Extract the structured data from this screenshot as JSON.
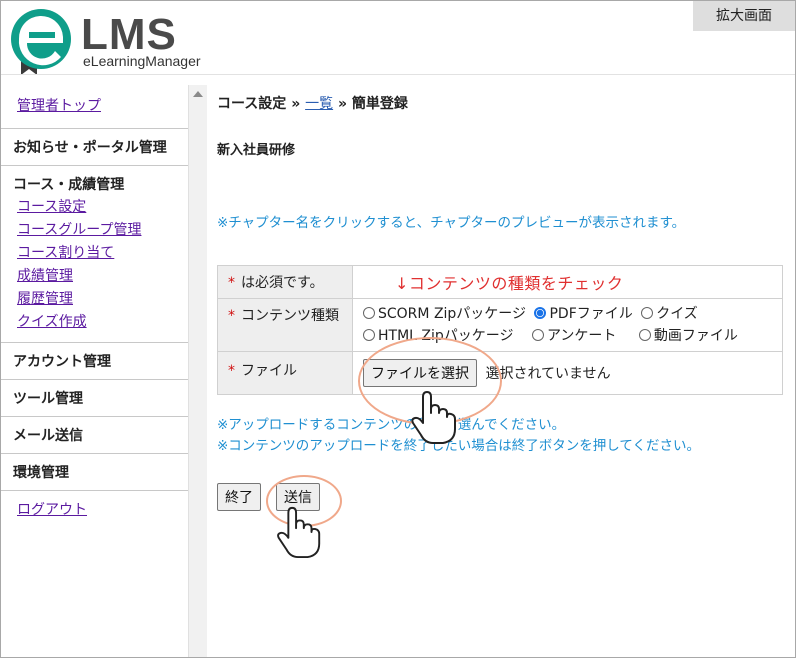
{
  "header": {
    "zoom_label": "拡大画面",
    "logo_text": "LMS",
    "logo_sub": "eLearningManager"
  },
  "sidebar": {
    "admin_top": "管理者トップ",
    "notice_portal": "お知らせ・ポータル管理",
    "course_group_title": "コース・成績管理",
    "course_links": [
      "コース設定",
      "コースグループ管理",
      "コース割り当て",
      "成績管理",
      "履歴管理",
      "クイズ作成"
    ],
    "account": "アカウント管理",
    "tools": "ツール管理",
    "mail": "メール送信",
    "env": "環境管理",
    "logout": "ログアウト"
  },
  "main": {
    "crumb_1": "コース設定",
    "crumb_sep": "»",
    "crumb_link": "一覧",
    "crumb_3": "簡単登録",
    "course_name": "新入社員研修",
    "hint": "※チャプター名をクリックすると、チャプターのプレビューが表示されます。",
    "form": {
      "required_star": "*",
      "required_note": "は必須です。",
      "annotation": "↓コンテンツの種類をチェック",
      "content_type_label": "コンテンツ種類",
      "options_row1": [
        "SCORM Zipパッケージ",
        "PDFファイル",
        "クイズ"
      ],
      "options_row2": [
        "HTML Zipパッケージ",
        "アンケート",
        "動画ファイル"
      ],
      "selected_option": "PDFファイル",
      "file_label": "ファイル",
      "file_button": "ファイルを選択",
      "file_status": "選択されていません"
    },
    "note_1": "※アップロードするコンテンツの種類を選んでください。",
    "note_2": "※コンテンツのアップロードを終了したい場合は終了ボタンを押してください。",
    "btn_finish": "終了",
    "btn_send": "送信"
  },
  "colors": {
    "accent_teal": "#0f9e8a",
    "link_purple": "#5b1aa0",
    "hint_blue": "#1f8fd1",
    "annotation_red": "#e03030",
    "ring_orange": "#f0a88a"
  }
}
